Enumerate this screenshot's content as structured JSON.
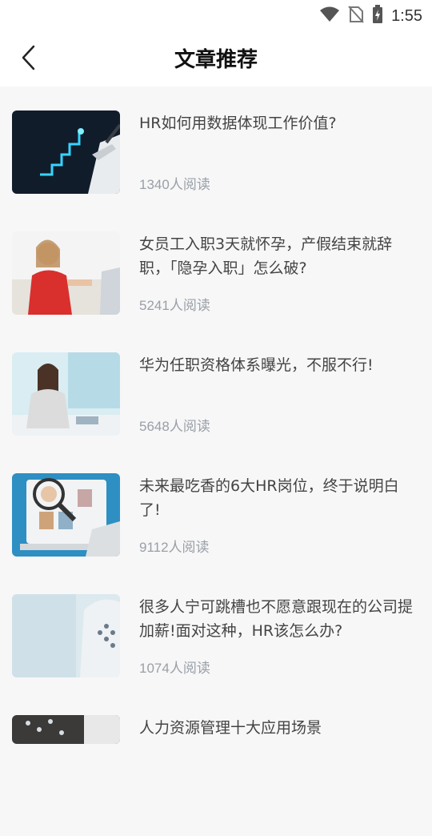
{
  "status_bar": {
    "time": "1:55"
  },
  "header": {
    "title": "文章推荐"
  },
  "articles": [
    {
      "title": "HR如何用数据体现工作价值?",
      "reads": "1340人阅读"
    },
    {
      "title": "女员工入职3天就怀孕，产假结束就辞职，「隐孕入职」怎么破?",
      "reads": "5241人阅读"
    },
    {
      "title": "华为任职资格体系曝光，不服不行!",
      "reads": "5648人阅读"
    },
    {
      "title": "未来最吃香的6大HR岗位，终于说明白了!",
      "reads": "9112人阅读"
    },
    {
      "title": "很多人宁可跳槽也不愿意跟现在的公司提加薪!面对这种，HR该怎么办?",
      "reads": "1074人阅读"
    },
    {
      "title": "人力资源管理十大应用场景",
      "reads": ""
    }
  ]
}
